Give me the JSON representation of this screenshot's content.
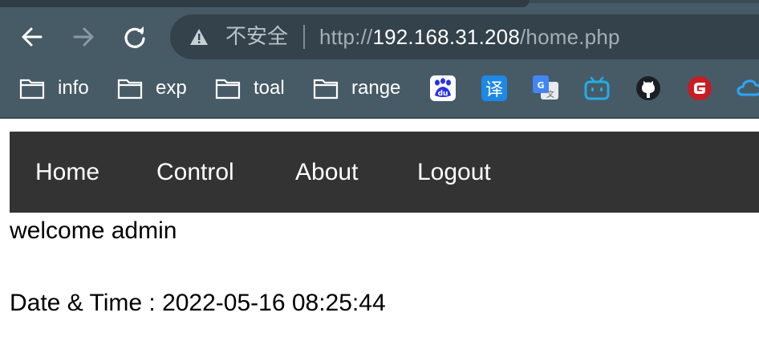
{
  "browser": {
    "security_label": "不安全",
    "url": {
      "scheme": "http://",
      "host": "192.168.31.208",
      "path": "/home.php"
    },
    "bookmarks": [
      {
        "label": "info",
        "icon": "folder-icon"
      },
      {
        "label": "exp",
        "icon": "folder-icon"
      },
      {
        "label": "toal",
        "icon": "folder-icon"
      },
      {
        "label": "range",
        "icon": "folder-icon"
      }
    ],
    "bookmark_icons": [
      "baidu-icon",
      "translate-icon",
      "google-translate-icon",
      "bilibili-icon",
      "github-icon",
      "gitee-icon",
      "cloud-icon"
    ],
    "colors": {
      "chrome_bg": "#475b67",
      "omnibox_bg": "#33424b"
    }
  },
  "page": {
    "nav": {
      "items": [
        "Home",
        "Control",
        "About",
        "Logout"
      ],
      "bg": "#333333"
    },
    "welcome": "welcome admin",
    "datetime": "Date & Time : 2022-05-16 08:25:44"
  }
}
